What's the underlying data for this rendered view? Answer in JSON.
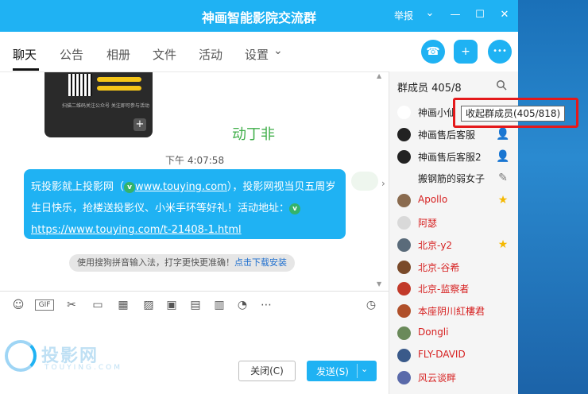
{
  "window": {
    "title": "神画智能影院交流群",
    "report": "举报",
    "chevron": "⌄",
    "minimize": "—",
    "maximize": "☐",
    "close": "✕"
  },
  "tabs": [
    {
      "label": "聊天",
      "active": true
    },
    {
      "label": "公告"
    },
    {
      "label": "相册"
    },
    {
      "label": "文件"
    },
    {
      "label": "活动"
    },
    {
      "label": "设置"
    }
  ],
  "tab_dropdown": "⌄",
  "actions": {
    "phone": "☎",
    "chat_add": "+",
    "more": "•••"
  },
  "chat": {
    "image_caption": "扫描二维码关注公众号 关注即可参与活动",
    "image_plus": "+",
    "sender": "动丁非",
    "time": "下午 4:07:58",
    "message": {
      "part1": "玩投影就上投影网（",
      "link1": "www.touying.com",
      "part2": "），投影网视当贝五周岁生日快乐，抢楼送投影仪、小米手环等好礼！活动地址：",
      "link2": "https://www.touying.com/t-21408-1.html",
      "badge": "v"
    },
    "expand": "›",
    "tip": "使用搜狗拼音输入法，打字更快更准确！",
    "tip_link": "点击下载安装",
    "scroll_up": "▲",
    "scroll_down": "▼"
  },
  "toolbar": {
    "tools": [
      {
        "name": "emoji-icon",
        "glyph": "☺"
      },
      {
        "name": "gif-icon",
        "glyph": "GIF"
      },
      {
        "name": "scissors-icon",
        "glyph": "✂"
      },
      {
        "name": "folder-icon",
        "glyph": "▭"
      },
      {
        "name": "sticker-icon",
        "glyph": "▦"
      },
      {
        "name": "image-icon",
        "glyph": "▨"
      },
      {
        "name": "game-icon",
        "glyph": "▣"
      },
      {
        "name": "gift-icon",
        "glyph": "▤"
      },
      {
        "name": "redpacket-icon",
        "glyph": "▥"
      },
      {
        "name": "bell-icon",
        "glyph": "◔"
      },
      {
        "name": "more-icon",
        "glyph": "⋯"
      }
    ],
    "history": "◷"
  },
  "watermark": {
    "text": "投影网",
    "sub": "TOUYING.COM"
  },
  "buttons": {
    "close": "关闭(C)",
    "send": "发送(S)",
    "send_arrow": "⌄"
  },
  "members": {
    "title": "群成员",
    "count": "405/8",
    "tooltip": "收起群成员(405/818)",
    "list": [
      {
        "name": "神画小仙",
        "color": "dark",
        "avatar": "#ffffff",
        "role": ""
      },
      {
        "name": "神画售后客服",
        "color": "dark",
        "avatar": "#222222",
        "role": "admin"
      },
      {
        "name": "神画售后客服2",
        "color": "dark",
        "avatar": "#222222",
        "role": "admin"
      },
      {
        "name": "搬钢筋的弱女子",
        "color": "dark",
        "avatar": "#f5f5f5",
        "role": "edit"
      },
      {
        "name": "Apollo",
        "color": "red",
        "avatar": "#8a6b4f",
        "role": "star"
      },
      {
        "name": "阿瑟",
        "color": "red",
        "avatar": "#d9d9d9",
        "role": ""
      },
      {
        "name": "北京-y2",
        "color": "red",
        "avatar": "#5a6b7a",
        "role": "star"
      },
      {
        "name": "北京-谷希",
        "color": "red",
        "avatar": "#7a4a2a",
        "role": ""
      },
      {
        "name": "北京-监察者",
        "color": "red",
        "avatar": "#c23a2a",
        "role": ""
      },
      {
        "name": "本座阴川紅樓君",
        "color": "red",
        "avatar": "#b0502a",
        "role": ""
      },
      {
        "name": "Dongli",
        "color": "red",
        "avatar": "#6a8a5a",
        "role": ""
      },
      {
        "name": "FLY-DAVID",
        "color": "red",
        "avatar": "#3a5a8a",
        "role": ""
      },
      {
        "name": "风云谈畔",
        "color": "red",
        "avatar": "#5a6aaa",
        "role": ""
      }
    ]
  }
}
